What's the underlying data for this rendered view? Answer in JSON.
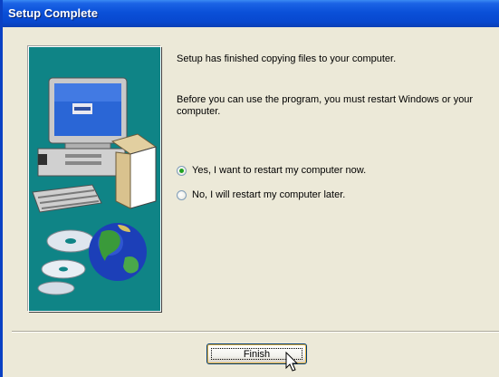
{
  "window": {
    "title": "Setup Complete"
  },
  "messages": {
    "copied": "Setup has finished copying files to your computer.",
    "restart": "Before you can use the program, you must restart Windows or your computer."
  },
  "options": {
    "yes_label": "Yes, I want to restart my computer now.",
    "no_label": "No, I will restart my computer later.",
    "selected": "yes"
  },
  "buttons": {
    "finish_label": "Finish"
  },
  "colors": {
    "title_bar": "#0a50d8",
    "dialog_bg": "#ece9d8",
    "art_bg": "#0f8486"
  },
  "icons": {
    "art": "computer-with-cds-and-globe",
    "pointer": "arrow-cursor-icon"
  }
}
